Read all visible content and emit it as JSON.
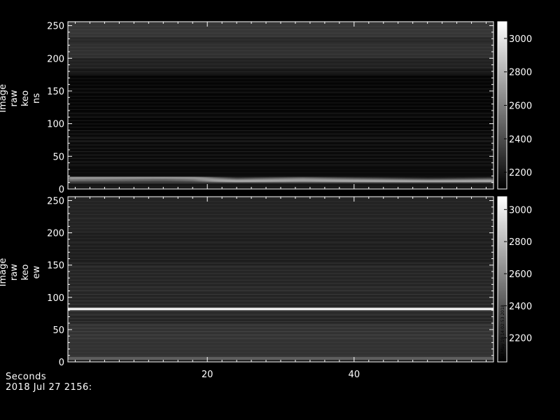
{
  "chart_data": [
    {
      "type": "heatmap",
      "ylabel": [
        "Image",
        "raw",
        "keo",
        "ns"
      ],
      "yticks": [
        0,
        50,
        100,
        150,
        200,
        250
      ],
      "ylim": [
        0,
        256
      ],
      "xticks": [
        20,
        40
      ],
      "xlim": [
        1,
        59
      ],
      "colorbar": {
        "ticks": [
          2200,
          2400,
          2600,
          2800,
          3000
        ],
        "range": [
          2100,
          3100
        ],
        "colormap": "grayscale",
        "stamp": ""
      },
      "background_levels": [
        {
          "y_range": [
            0,
            8
          ],
          "value": 2180
        },
        {
          "y_range": [
            8,
            14
          ],
          "value": 2300
        },
        {
          "y_range": [
            14,
            90
          ],
          "value": 2140
        },
        {
          "y_range": [
            90,
            175
          ],
          "value": 2120
        },
        {
          "y_range": [
            175,
            185
          ],
          "value": 2190
        },
        {
          "y_range": [
            185,
            200
          ],
          "value": 2230
        },
        {
          "y_range": [
            200,
            222
          ],
          "value": 2290
        },
        {
          "y_range": [
            222,
            232
          ],
          "value": 2260
        },
        {
          "y_range": [
            232,
            256
          ],
          "value": 2310
        }
      ],
      "bright_feature": {
        "peak_value": 3000,
        "path_x": [
          1,
          8,
          14,
          18,
          21,
          24,
          28,
          33,
          38,
          44,
          50,
          55,
          59
        ],
        "path_y": [
          17,
          17.5,
          18,
          17,
          14,
          12,
          13,
          14,
          13,
          12,
          11,
          11.5,
          12
        ]
      }
    },
    {
      "type": "heatmap",
      "ylabel": [
        "Image",
        "raw",
        "keo",
        "ew"
      ],
      "yticks": [
        0,
        50,
        100,
        150,
        200,
        250
      ],
      "ylim": [
        0,
        256
      ],
      "xticks": [
        20,
        40
      ],
      "xlim": [
        1,
        59
      ],
      "colorbar": {
        "ticks": [
          2200,
          2400,
          2600,
          2800,
          3000
        ],
        "range": [
          2050,
          3080
        ],
        "colormap": "grayscale",
        "stamp": "Sat May 19 14:02:53 2018"
      },
      "background_levels": [
        {
          "y_range": [
            0,
            3
          ],
          "value": 2150
        },
        {
          "y_range": [
            3,
            8
          ],
          "value": 2420
        },
        {
          "y_range": [
            8,
            60
          ],
          "value": 2250
        },
        {
          "y_range": [
            60,
            80
          ],
          "value": 2200
        },
        {
          "y_range": [
            80,
            84
          ],
          "value": 3000
        },
        {
          "y_range": [
            84,
            150
          ],
          "value": 2200
        },
        {
          "y_range": [
            150,
            200
          ],
          "value": 2170
        },
        {
          "y_range": [
            200,
            256
          ],
          "value": 2190
        }
      ]
    }
  ],
  "footer": {
    "xlabel": "Seconds",
    "date": "2018 Jul 27 2156:"
  }
}
